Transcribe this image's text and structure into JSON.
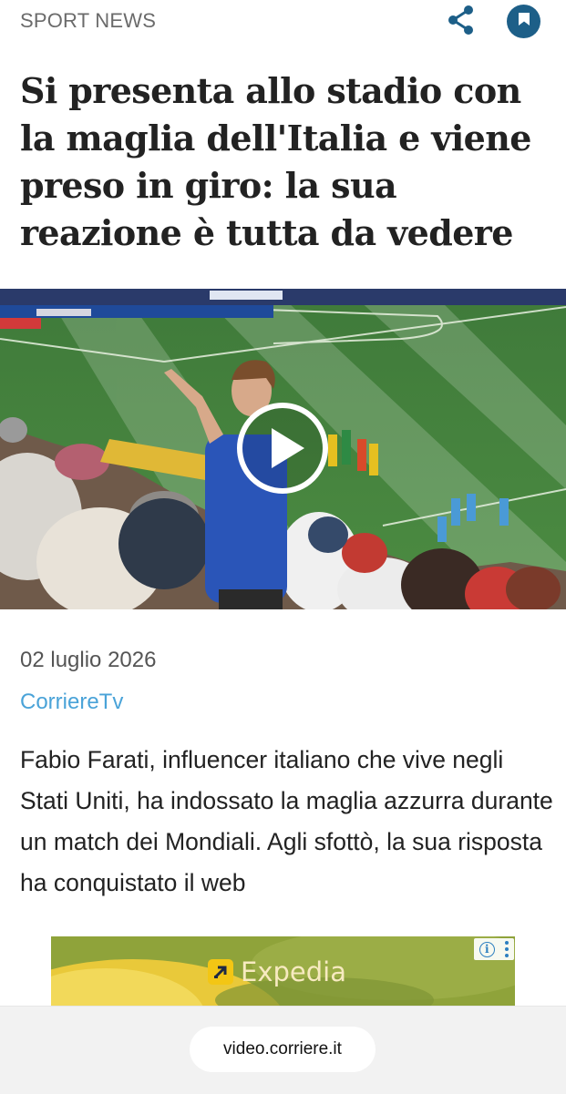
{
  "header": {
    "section_label": "SPORT NEWS",
    "share_icon": "share-icon",
    "bookmark_icon": "bookmark-icon",
    "accent_color": "#1d5f88"
  },
  "article": {
    "headline": "Si presenta allo stadio con la maglia dell'Italia e viene preso in giro: la sua reazione è tutta da vedere",
    "date": "02 luglio 2026",
    "source": "CorriereTv",
    "summary": "Fabio Farati, influencer italiano che vive negli Stati Uniti, ha indossato la maglia azzurra durante un match dei Mondiali. Agli sfottò, la sua risposta ha conquistato il web"
  },
  "video": {
    "play_icon": "play-icon"
  },
  "ad": {
    "brand": "Expedia",
    "info_icon": "info-icon",
    "menu_icon": "more-vertical-icon"
  },
  "browser": {
    "url": "video.corriere.it"
  }
}
